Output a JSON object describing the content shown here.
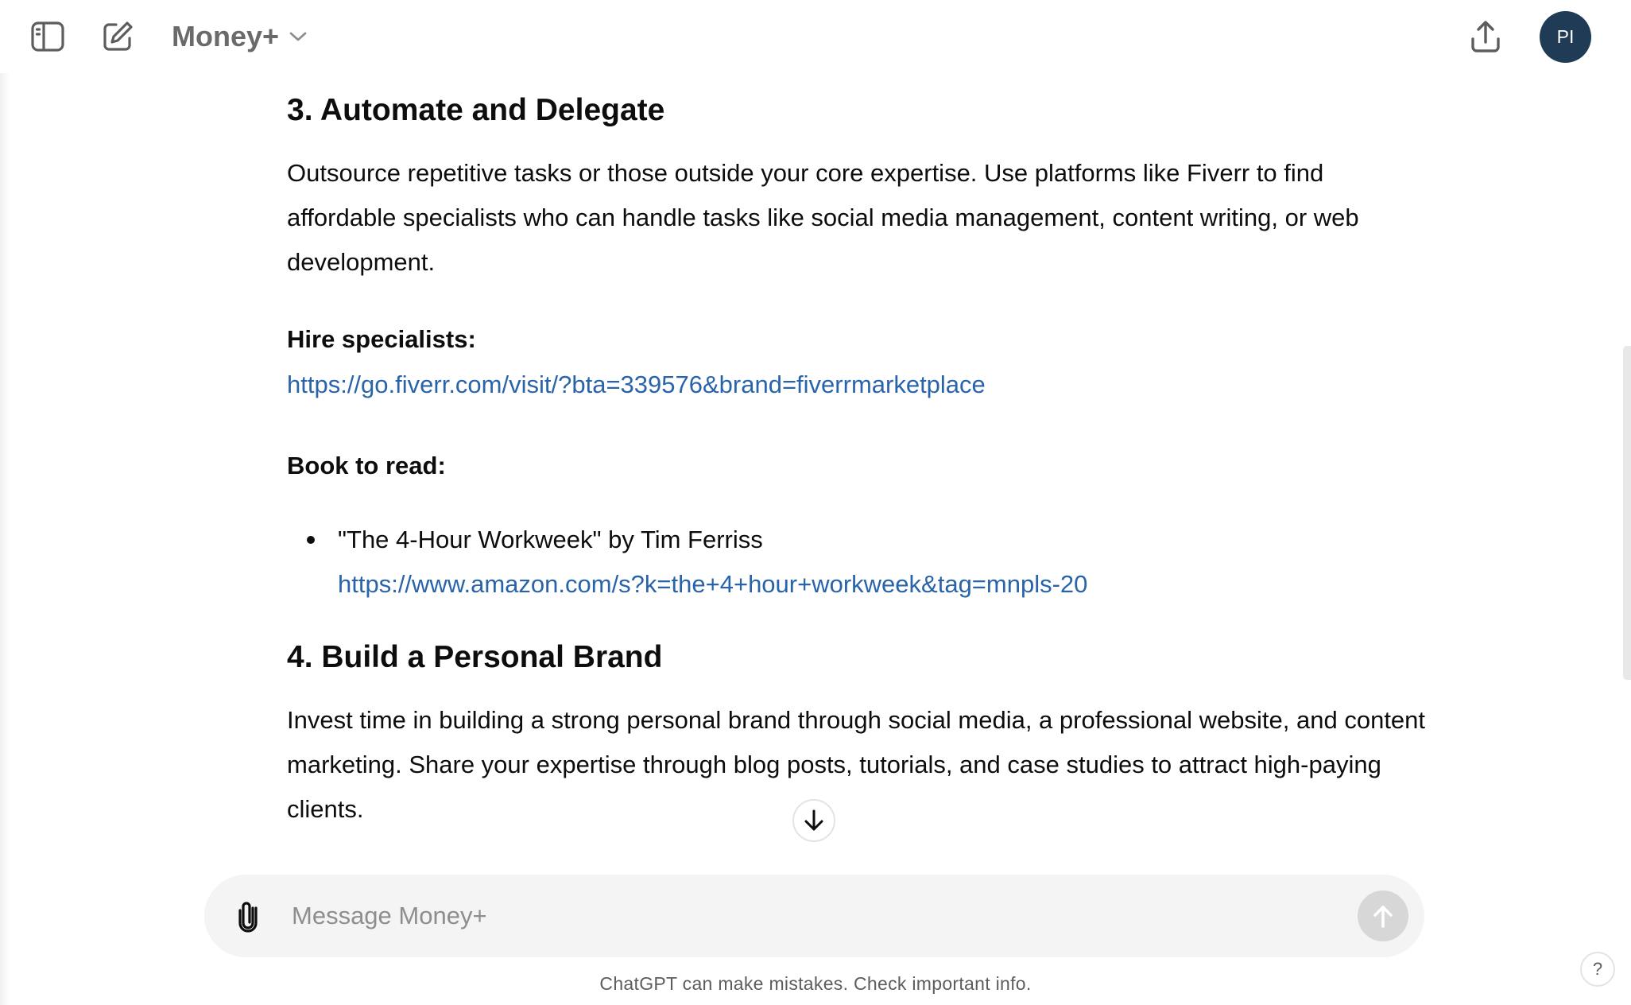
{
  "header": {
    "sidebar_icon": "sidebar-toggle-icon",
    "new_chat_icon": "new-chat-icon",
    "model_name": "Money+",
    "share_icon": "share-icon",
    "avatar_initials": "PI"
  },
  "content": {
    "section3": {
      "heading": "3. Automate and Delegate",
      "body": "Outsource repetitive tasks or those outside your core expertise. Use platforms like Fiverr to find affordable specialists who can handle tasks like social media management, content writing, or web development.",
      "hire_label": "Hire specialists:",
      "hire_link": "https://go.fiverr.com/visit/?bta=339576&brand=fiverrmarketplace",
      "book_label": "Book to read:",
      "books": [
        {
          "title": "\"The 4-Hour Workweek\" by Tim Ferriss",
          "link": "https://www.amazon.com/s?k=the+4+hour+workweek&tag=mnpls-20"
        }
      ]
    },
    "section4": {
      "heading": "4. Build a Personal Brand",
      "body": "Invest time in building a strong personal brand through social media, a professional website, and content marketing. Share your expertise through blog posts, tutorials, and case studies to attract high-paying clients."
    }
  },
  "composer": {
    "placeholder": "Message Money+",
    "value": ""
  },
  "footer": {
    "disclaimer": "ChatGPT can make mistakes. Check important info.",
    "help_label": "?"
  },
  "colors": {
    "link": "#2964aa",
    "avatar_bg": "#1f3b55",
    "composer_bg": "#f4f4f4",
    "send_disabled": "#d7d7d7"
  }
}
